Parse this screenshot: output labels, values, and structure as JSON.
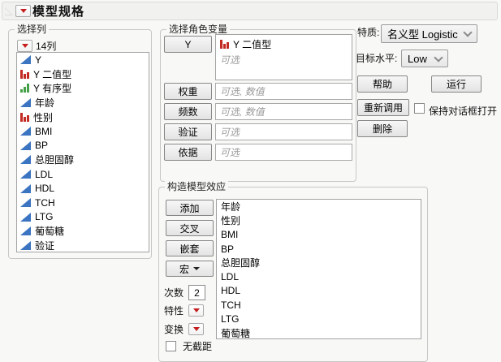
{
  "header": {
    "title": "模型规格"
  },
  "select_columns": {
    "label": "选择列",
    "count_label": "14列",
    "items": [
      {
        "name": "Y",
        "type": "continuous"
      },
      {
        "name": "Y 二值型",
        "type": "nominal"
      },
      {
        "name": "Y 有序型",
        "type": "ordinal"
      },
      {
        "name": "年龄",
        "type": "continuous"
      },
      {
        "name": "性别",
        "type": "nominal"
      },
      {
        "name": "BMI",
        "type": "continuous"
      },
      {
        "name": "BP",
        "type": "continuous"
      },
      {
        "name": "总胆固醇",
        "type": "continuous"
      },
      {
        "name": "LDL",
        "type": "continuous"
      },
      {
        "name": "HDL",
        "type": "continuous"
      },
      {
        "name": "TCH",
        "type": "continuous"
      },
      {
        "name": "LTG",
        "type": "continuous"
      },
      {
        "name": "葡萄糖",
        "type": "continuous"
      },
      {
        "name": "验证",
        "type": "continuous"
      }
    ]
  },
  "roles": {
    "label": "选择角色变量",
    "y": {
      "button": "Y",
      "item": "Y 二值型",
      "item_type": "nominal",
      "placeholder": "可选"
    },
    "rows": [
      {
        "button": "权重",
        "placeholder": "可选, 数值"
      },
      {
        "button": "频数",
        "placeholder": "可选, 数值"
      },
      {
        "button": "验证",
        "placeholder": "可选"
      },
      {
        "button": "依据",
        "placeholder": "可选"
      }
    ]
  },
  "effects": {
    "label": "构造模型效应",
    "buttons": [
      "添加",
      "交叉",
      "嵌套"
    ],
    "macros_label": "宏",
    "degree_label": "次数",
    "degree_value": "2",
    "attributes_label": "特性",
    "transform_label": "变换",
    "no_intercept_label": "无截距",
    "items": [
      "年龄",
      "性别",
      "BMI",
      "BP",
      "总胆固醇",
      "LDL",
      "HDL",
      "TCH",
      "LTG",
      "葡萄糖"
    ]
  },
  "personality": {
    "label": "特质:",
    "value": "名义型 Logistic"
  },
  "target_level": {
    "label": "目标水平:",
    "value": "Low"
  },
  "actions": {
    "help": "帮助",
    "run": "运行",
    "recall": "重新调用",
    "remove": "删除",
    "keep_open": "保持对话框打开"
  },
  "colors": {
    "accent_red": "#c41e1e",
    "continuous_blue": "#3b74c0",
    "nominal_red": "#c32b22",
    "ordinal_green": "#43a047"
  }
}
